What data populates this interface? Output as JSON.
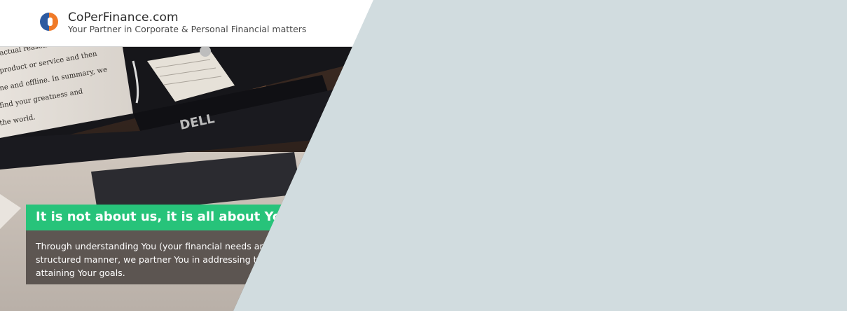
{
  "header": {
    "brand_name": "CoPerFinance.com",
    "tagline": "Your Partner in Corporate & Personal Financial matters",
    "logo_icon": "coperfinance-logo-icon"
  },
  "hero": {
    "photo_text_lines": [
      "actual reasons why people",
      "product or service and then",
      "ne and offline. In summary, we",
      "find your greatness and",
      "the world."
    ],
    "monitor_brand": "DELL",
    "headline": "It is not about us, it is all about You",
    "description": "Through understanding You (your financial needs and/or goals) in a structured manner, we partner You in addressing to Your needs, and attaining Your goals."
  },
  "colors": {
    "accent_green": "#27c37a",
    "logo_blue": "#2d5aa0",
    "logo_orange": "#f07a27",
    "right_background": "#d1dcdf"
  }
}
